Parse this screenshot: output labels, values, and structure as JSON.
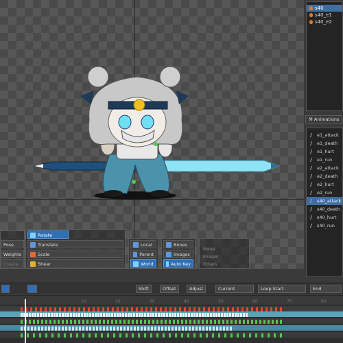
{
  "skins": {
    "items": [
      {
        "label": "s40",
        "selected": true
      },
      {
        "label": "s40_e1",
        "selected": false
      },
      {
        "label": "s40_e2",
        "selected": false
      }
    ]
  },
  "animations_panel": {
    "tab_label": "Animations",
    "items": [
      {
        "label": "e1_attack",
        "selected": false
      },
      {
        "label": "e1_death",
        "selected": false
      },
      {
        "label": "e1_hurt",
        "selected": false
      },
      {
        "label": "e1_run",
        "selected": false
      },
      {
        "label": "e2_attack",
        "selected": false
      },
      {
        "label": "e2_death",
        "selected": false
      },
      {
        "label": "e2_hurt",
        "selected": false
      },
      {
        "label": "e2_run",
        "selected": false
      },
      {
        "label": "s40_attack",
        "selected": true
      },
      {
        "label": "s40_death",
        "selected": false
      },
      {
        "label": "s40_hurt",
        "selected": false
      },
      {
        "label": "s40_run",
        "selected": false
      }
    ]
  },
  "tools": {
    "pose": "Pose",
    "weights": "Weights",
    "create": "Create",
    "rotate": "Rotate",
    "translate": "Translate",
    "scale": "Scale",
    "shear": "Shear",
    "local": "Local",
    "parent": "Parent",
    "world": "World",
    "bones": "Bones",
    "images": "Images",
    "auto_key": "Auto Key",
    "filter_bones": "Bones",
    "filter_images": "Images",
    "filter_others": "Others"
  },
  "timeline_bar": {
    "shift": "Shift",
    "offset": "Offset",
    "adjust": "Adjust",
    "current": "Current",
    "loop_start": "Loop Start",
    "end": "End"
  },
  "ruler": {
    "ticks": [
      "10",
      "20",
      "30",
      "40",
      "50",
      "60",
      "70",
      "80"
    ]
  },
  "colors": {
    "accent": "#2f6fb5",
    "selection": "#3f6fa0",
    "track_teal": "#5aa3b8",
    "key_red": "#e04a2a",
    "key_green": "#4fc850"
  }
}
